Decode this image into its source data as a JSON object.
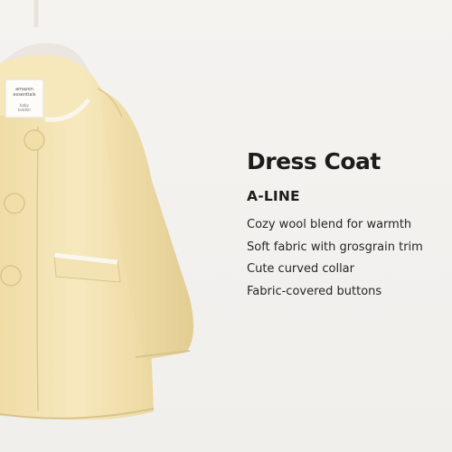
{
  "product": {
    "title": "Dress Coat",
    "subtitle": "A-LINE",
    "features": [
      "Cozy wool blend for warmth",
      "Soft fabric with grosgrain trim",
      "Cute curved collar",
      "Fabric-covered buttons"
    ]
  },
  "image": {
    "subject": "coat-illustration",
    "tag_lines": [
      "amazon",
      "essentials",
      "baby",
      "toddler"
    ]
  },
  "colors": {
    "background": "#f3f1ee",
    "coat": "#f6e7b8",
    "coat_shadow": "#e5d29c",
    "trim": "#fbf8f0",
    "text": "#1c1c1c"
  }
}
